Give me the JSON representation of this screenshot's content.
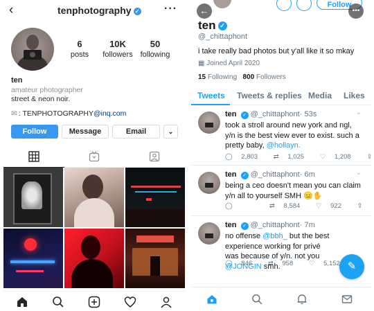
{
  "instagram": {
    "username": "tenphotography",
    "stats": [
      {
        "num": "6",
        "label": "posts"
      },
      {
        "num": "10K",
        "label": "followers"
      },
      {
        "num": "50",
        "label": "following"
      }
    ],
    "name": "ten",
    "category": "amateur photographer",
    "bio": "street & neon noir.",
    "email_prefix": ": TENPHOTOGRAPHY",
    "email_domain": "@inq.com",
    "buttons": {
      "follow": "Follow",
      "message": "Message",
      "email": "Email"
    },
    "accent": "#3897f0"
  },
  "twitter": {
    "follow_label": "Follow",
    "name": "ten",
    "handle": "@_chittaphont",
    "bio": "i take really bad photos but y'all like it so mkay",
    "joined": "Joined April 2020",
    "following_count": "15",
    "following_label": "Following",
    "followers_count": "800",
    "followers_label": "Followers",
    "tabs": [
      "Tweets",
      "Tweets & replies",
      "Media",
      "Likes"
    ],
    "accent": "#1da1f2",
    "tweets": [
      {
        "name": "ten",
        "handle": "@_chittaphont",
        "time": "· 53s",
        "text": "took a stroll around new york and ngl, y/n is the best view ever to exist. such a pretty baby, ",
        "mention": "@hollayn.",
        "replies": "2,803",
        "retweets": "1,025",
        "likes": "1,208"
      },
      {
        "name": "ten",
        "handle": "@_chittaphont",
        "time": "· 6m",
        "text": "being a ceo doesn't mean you can claim y/n all to yourself SMH 😑✋",
        "replies": "",
        "retweets": "8,584",
        "likes": "922"
      },
      {
        "name": "ten",
        "handle": "@_chittaphont",
        "time": "· 7m",
        "text_a": "no offense ",
        "mention_a": "@bbh_",
        "text_b": " but the best experience working for privé was because of y/n. not you ",
        "mention_b": "@JONGIN",
        "text_c": " smh.",
        "replies": "846",
        "retweets": "958",
        "likes": "5,152"
      }
    ]
  }
}
